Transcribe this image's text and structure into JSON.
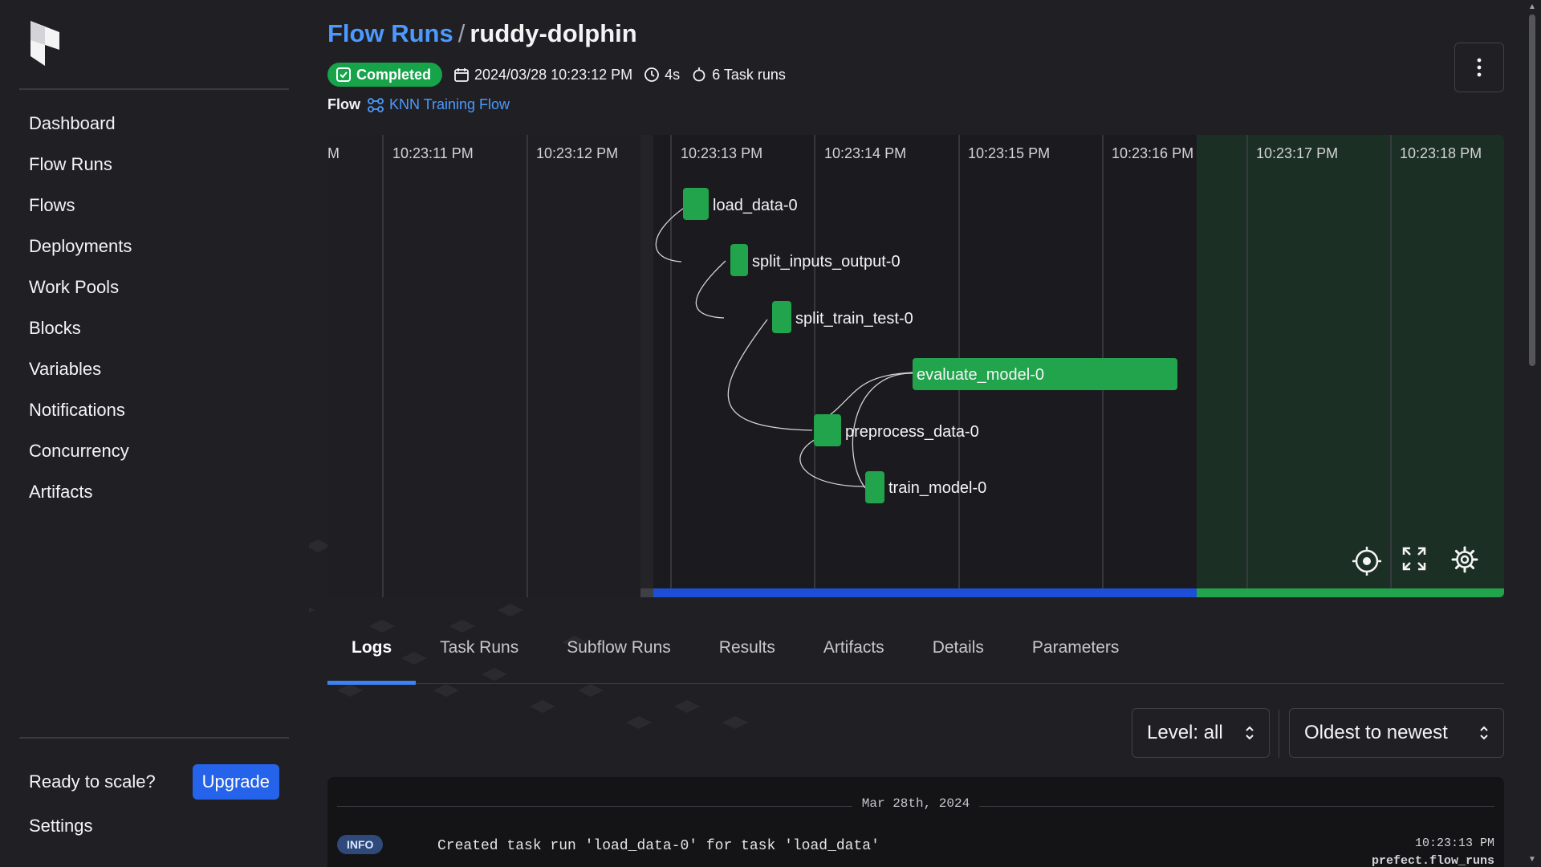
{
  "sidebar": {
    "items": [
      {
        "label": "Dashboard"
      },
      {
        "label": "Flow Runs"
      },
      {
        "label": "Flows"
      },
      {
        "label": "Deployments"
      },
      {
        "label": "Work Pools"
      },
      {
        "label": "Blocks"
      },
      {
        "label": "Variables"
      },
      {
        "label": "Notifications"
      },
      {
        "label": "Concurrency"
      },
      {
        "label": "Artifacts"
      }
    ],
    "scale_text": "Ready to scale?",
    "upgrade_label": "Upgrade",
    "settings_label": "Settings"
  },
  "header": {
    "breadcrumb_parent": "Flow Runs",
    "breadcrumb_sep": "/",
    "breadcrumb_current": "ruddy-dolphin",
    "status": "Completed",
    "start_time": "2024/03/28 10:23:12 PM",
    "duration": "4s",
    "task_runs": "6 Task runs",
    "flow_label": "Flow",
    "flow_name": "KNN Training Flow"
  },
  "timeline": {
    "ticks": [
      "M",
      "10:23:11 PM",
      "10:23:12 PM",
      "10:23:13 PM",
      "10:23:14 PM",
      "10:23:15 PM",
      "10:23:16 PM",
      "10:23:17 PM",
      "10:23:18 PM"
    ],
    "nodes": [
      {
        "label": "load_data-0"
      },
      {
        "label": "split_inputs_output-0"
      },
      {
        "label": "split_train_test-0"
      },
      {
        "label": "evaluate_model-0"
      },
      {
        "label": "preprocess_data-0"
      },
      {
        "label": "train_model-0"
      }
    ]
  },
  "tabs": [
    {
      "label": "Logs",
      "active": true
    },
    {
      "label": "Task Runs"
    },
    {
      "label": "Subflow Runs"
    },
    {
      "label": "Results"
    },
    {
      "label": "Artifacts"
    },
    {
      "label": "Details"
    },
    {
      "label": "Parameters"
    }
  ],
  "filters": {
    "level": "Level: all",
    "order": "Oldest to newest"
  },
  "logs": {
    "date": "Mar 28th, 2024",
    "entries": [
      {
        "level": "INFO",
        "message": "Created task run 'load_data-0' for task 'load_data'",
        "time": "10:23:13 PM",
        "logger": "prefect.flow_runs"
      }
    ]
  },
  "colors": {
    "accent": "#2563eb",
    "success": "#16a34a",
    "link": "#4c9aff",
    "background": "#202024"
  }
}
